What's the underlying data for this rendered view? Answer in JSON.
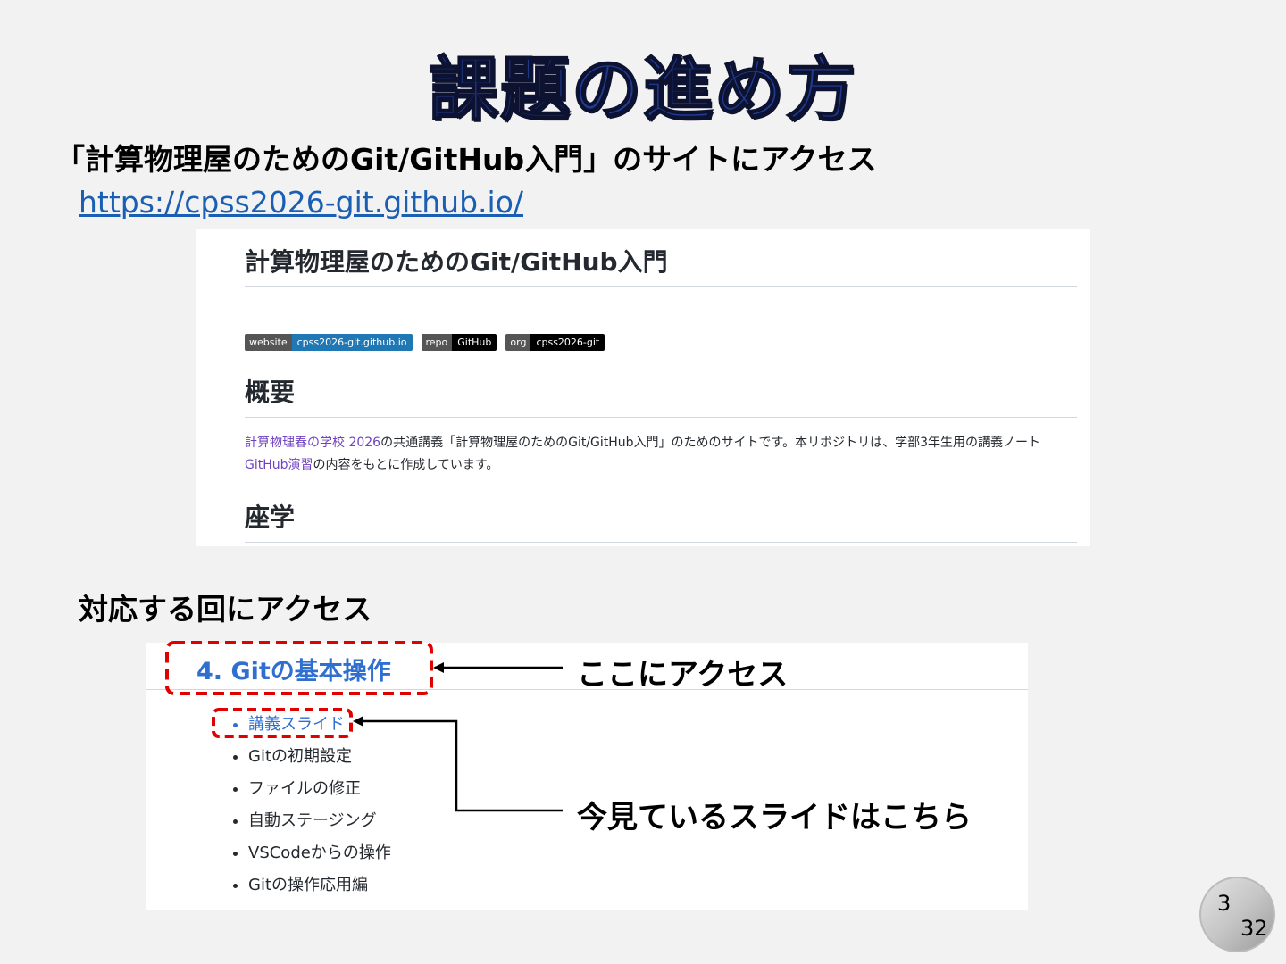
{
  "slide": {
    "title": "課題の進め方",
    "intro_text": "「計算物理屋のためのGit/GitHub入門」のサイトにアクセス",
    "url": "https://cpss2026-git.github.io/",
    "access_label": "対応する回にアクセス",
    "callout_access": "ここにアクセス",
    "callout_slides": "今見ているスライドはこちら",
    "page_current": "3",
    "page_total": "32"
  },
  "site": {
    "heading": "計算物理屋のためのGit/GitHub入門",
    "badges": [
      {
        "label": "website",
        "value": "cpss2026-git.github.io",
        "color": "#1f77b4"
      },
      {
        "label": "repo",
        "value": "GitHub",
        "color": "#000000"
      },
      {
        "label": "org",
        "value": "cpss2026-git",
        "color": "#000000"
      }
    ],
    "section_overview": "概要",
    "para_link1": "計算物理春の学校 2026",
    "para_text1": "の共通講義「計算物理屋のためのGit/GitHub入門」のためのサイトです。本リポジトリは、学部3年生用の講義ノート",
    "para_link2": "GitHub演習",
    "para_text2": "の内容をもとに作成しています。",
    "section_lecture": "座学"
  },
  "lesson": {
    "heading": "4. Gitの基本操作",
    "items": [
      "講義スライド",
      "Gitの初期設定",
      "ファイルの修正",
      "自動ステージング",
      "VSCodeからの操作",
      "Gitの操作応用編"
    ]
  },
  "colors": {
    "title": "#1f3a93",
    "link": "#1a5fb4",
    "highlight": "#e00000"
  }
}
